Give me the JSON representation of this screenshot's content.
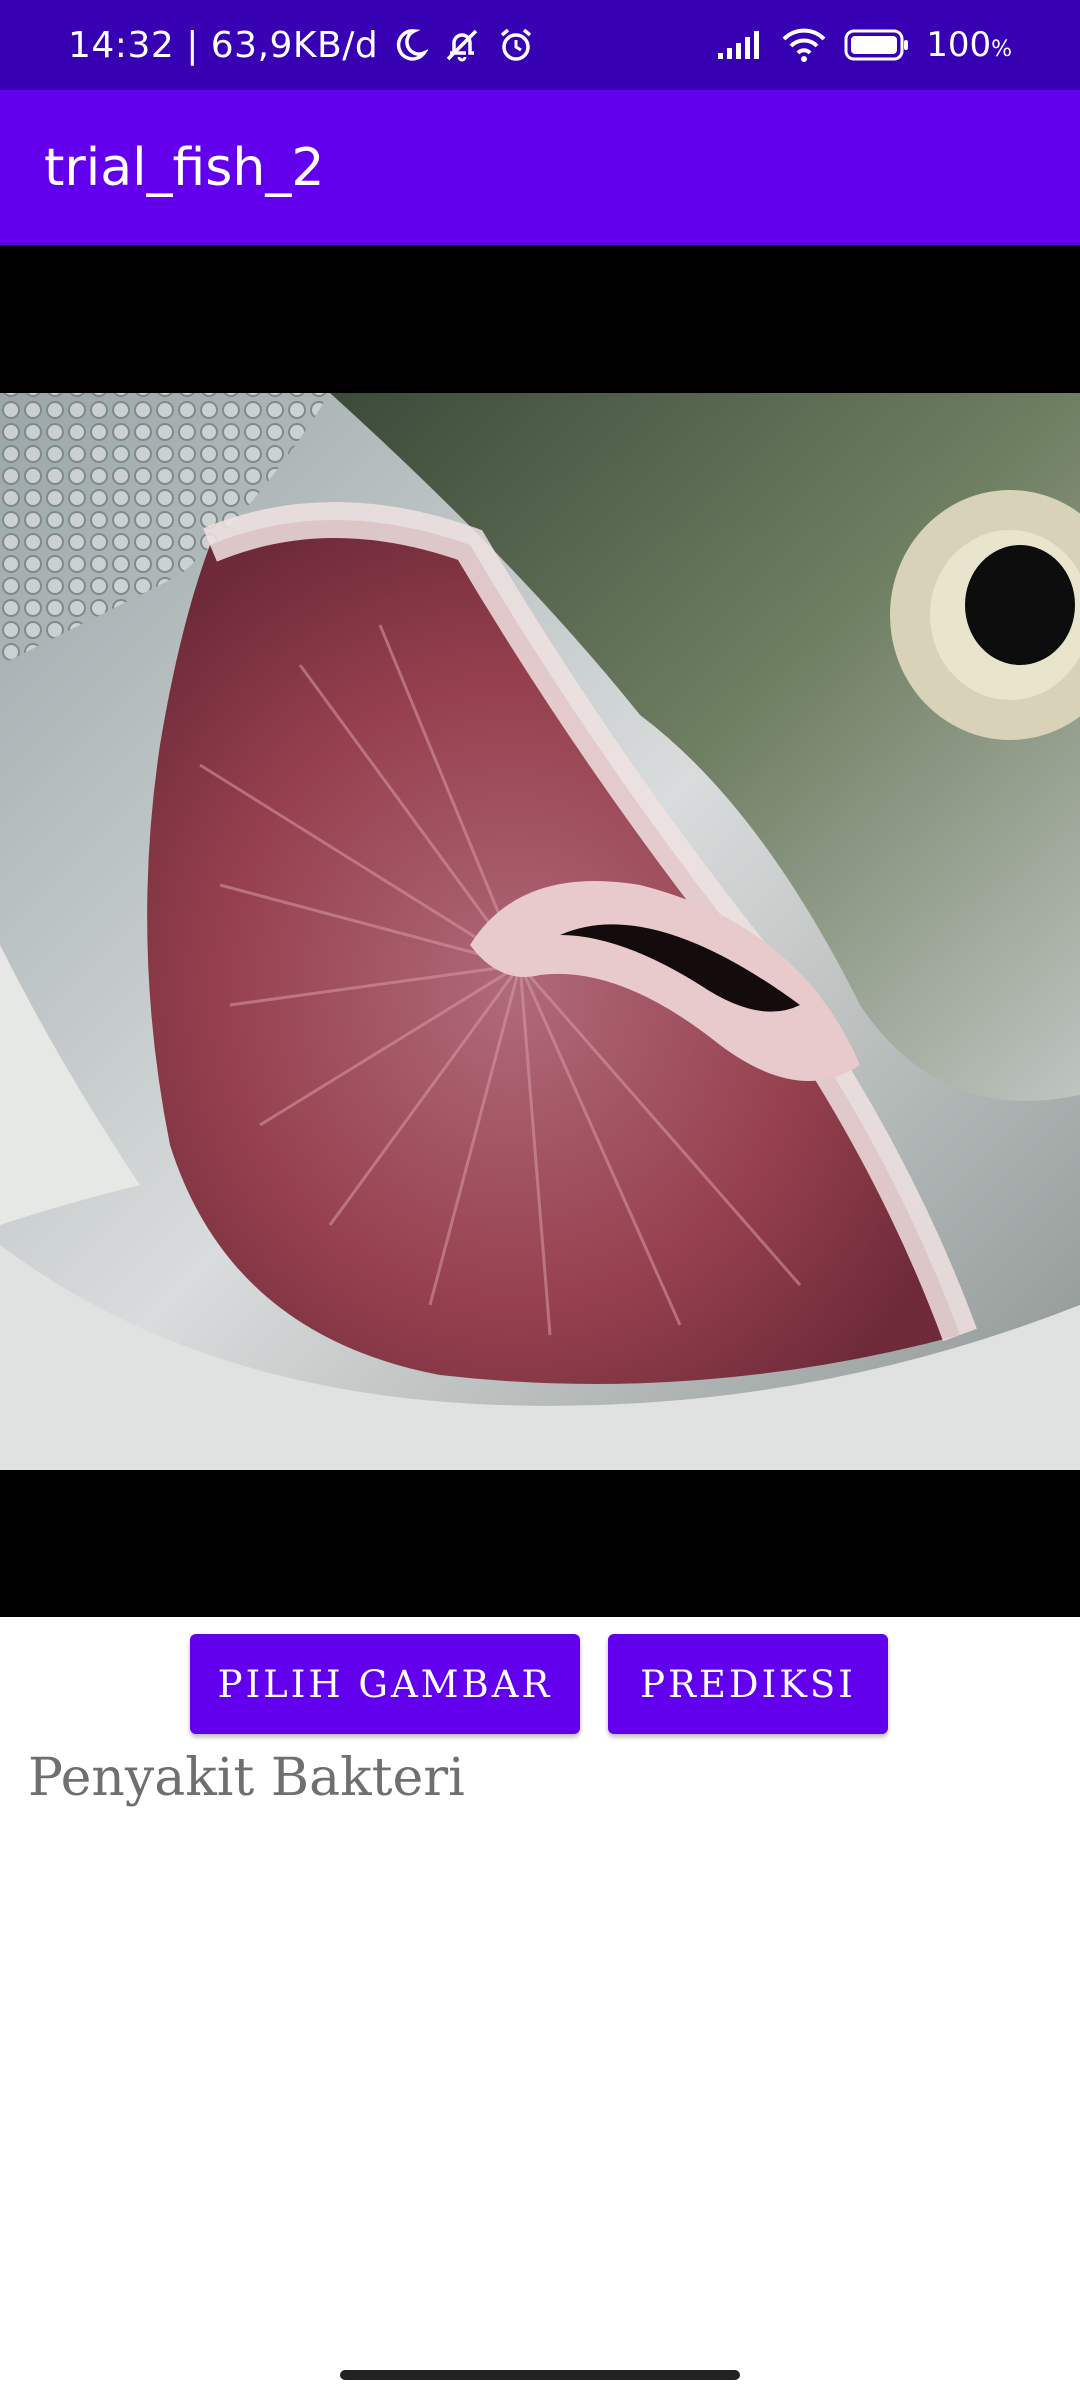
{
  "status_bar": {
    "time_and_speed": "14:32 | 63,9KB/d",
    "battery": "100",
    "battery_unit": "%",
    "icons": [
      "moon-icon",
      "mute-bell-icon",
      "alarm-icon",
      "signal-icon",
      "wifi-icon",
      "battery-icon"
    ],
    "background": "#3700B3"
  },
  "app_bar": {
    "title": "trial_fish_2",
    "background": "#6200EE"
  },
  "image": {
    "subject": "fish-gill-photo"
  },
  "buttons": {
    "pick_image": "PILIH GAMBAR",
    "predict": "PREDIKSI",
    "color": "#6200EE"
  },
  "result": {
    "text": "Penyakit Bakteri"
  }
}
